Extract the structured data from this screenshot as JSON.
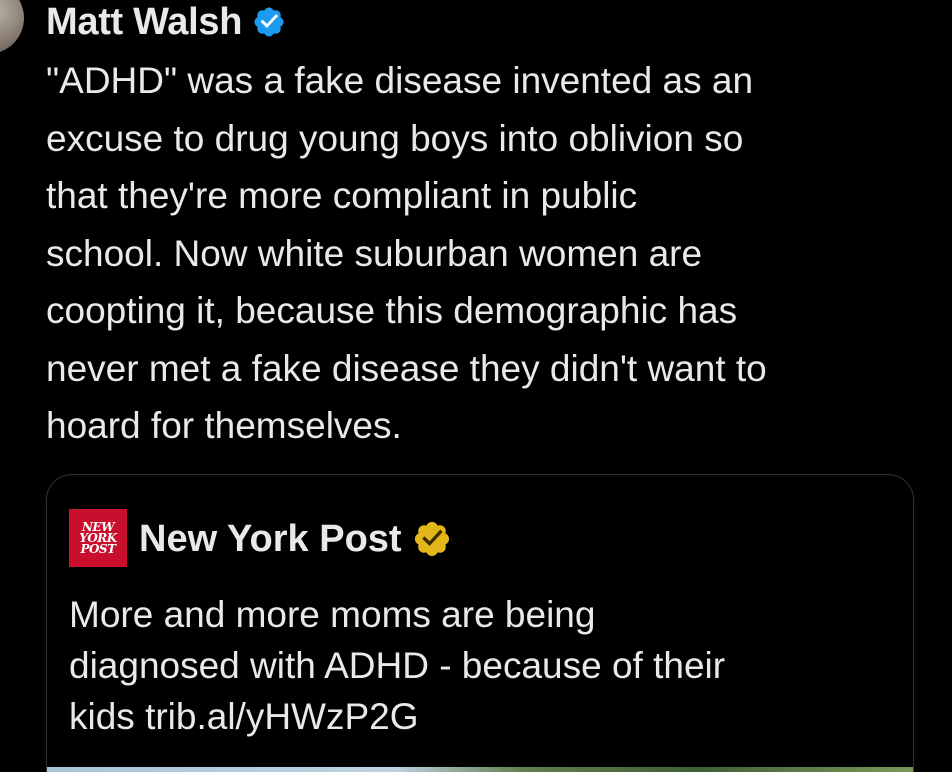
{
  "tweet": {
    "author_name": "Matt Walsh",
    "text": "\"ADHD\" was a fake disease invented as an\nexcuse to drug young boys into oblivion so\nthat they're more compliant in public\nschool. Now white suburban women are\ncoopting it, because this demographic has\nnever met a fake disease they didn't want to\nhoard for themselves."
  },
  "quote": {
    "logo_lines": [
      "NEW",
      "YORK",
      "POST"
    ],
    "author_name": "New York Post",
    "text": "More and more moms are being\ndiagnosed with ADHD - because of their\nkids trib.al/yHWzP2G"
  },
  "colors": {
    "background": "#000000",
    "text": "#e7e9ea",
    "verified_blue": "#1d9bf0",
    "verified_gold": "#e2b719",
    "nyp_red": "#c8102e",
    "card_border": "#2f3336"
  },
  "icons": {
    "author_badge": "verified-blue-badge-icon",
    "quote_badge": "verified-gold-badge-icon"
  }
}
